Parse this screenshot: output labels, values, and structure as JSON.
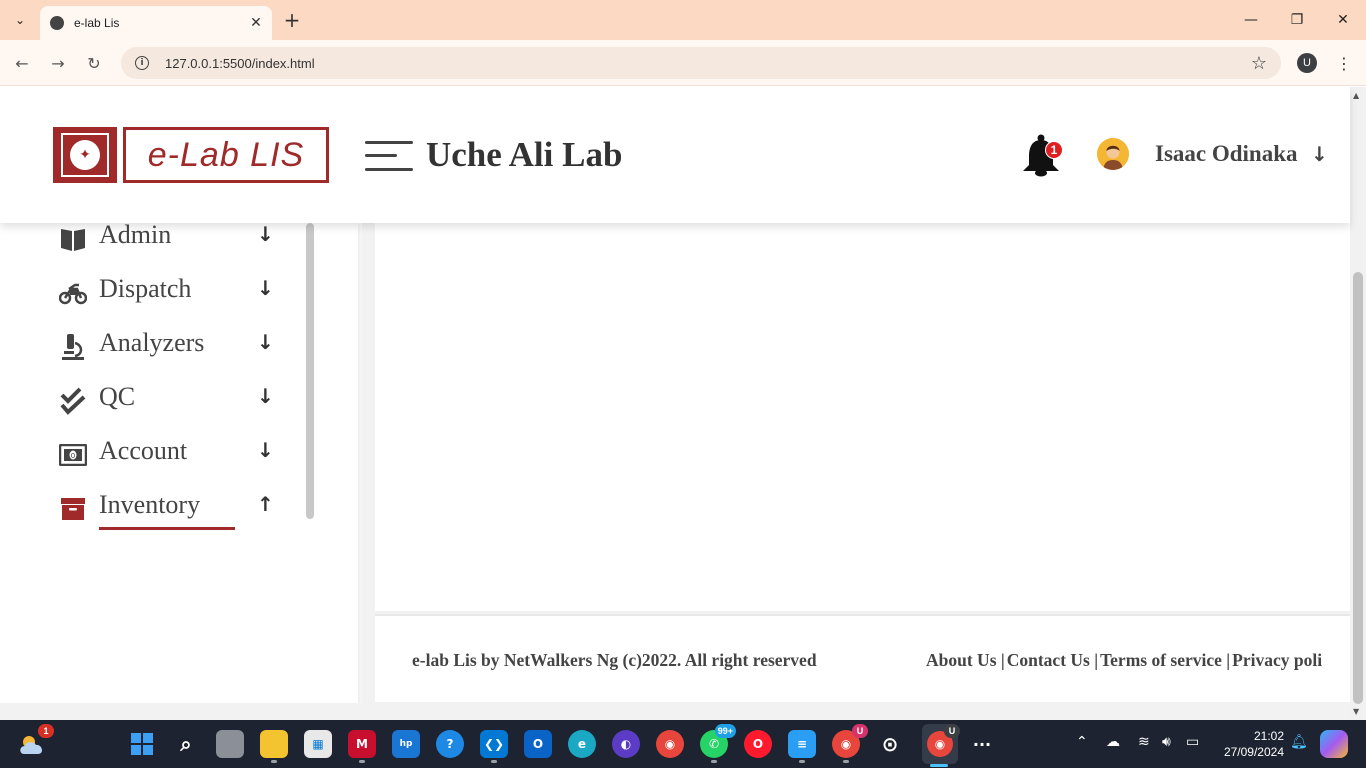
{
  "browser": {
    "tab_title": "e-lab Lis",
    "tab_close": "✕",
    "new_tab": "+",
    "url": "127.0.0.1:5500/index.html",
    "profile_initial": "U",
    "window_controls": [
      "—",
      "❐",
      "✕"
    ]
  },
  "header": {
    "logo_text": "e-Lab LIS",
    "lab_name": "Uche Ali Lab",
    "notification_count": "1",
    "user_name": "Isaac Odinaka",
    "user_menu_arrow": "↓"
  },
  "sidebar": {
    "items": [
      {
        "label": "Admin",
        "icon": "book-icon",
        "arrow": "↓"
      },
      {
        "label": "Dispatch",
        "icon": "motorcycle-icon",
        "arrow": "↓"
      },
      {
        "label": "Analyzers",
        "icon": "microscope-icon",
        "arrow": "↓"
      },
      {
        "label": "QC",
        "icon": "check-double-icon",
        "arrow": "↓"
      },
      {
        "label": "Account",
        "icon": "money-bill-icon",
        "arrow": "↓"
      },
      {
        "label": "Inventory",
        "icon": "archive-box-icon",
        "arrow": "↑",
        "active": true
      }
    ]
  },
  "footer": {
    "copyright": "e-lab Lis by NetWalkers Ng (c)2022. All right reserved",
    "links": [
      "About Us |",
      "Contact Us |",
      "Terms of service |",
      "Privacy poli"
    ]
  },
  "taskbar": {
    "weather_badge": "1",
    "whatsapp_badge": "99+",
    "chrome_profile_badge": "U",
    "active_chrome_badge": "U",
    "time": "21:02",
    "date": "27/09/2024",
    "more": "···"
  },
  "colors": {
    "brand": "#a02a2a",
    "titlebar": "#fcd9c3",
    "taskbar": "#1d2330"
  }
}
